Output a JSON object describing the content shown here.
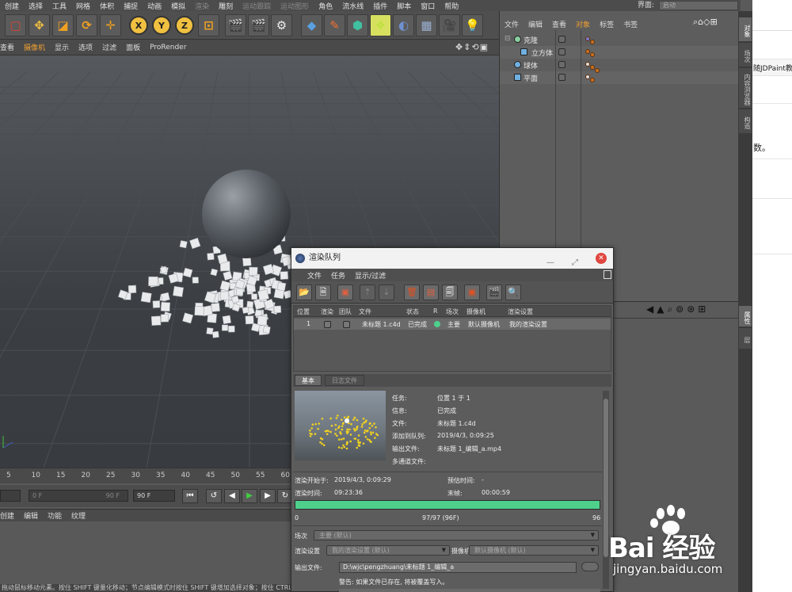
{
  "menubar": {
    "items": [
      "创建",
      "选择",
      "工具",
      "网格",
      "体积",
      "捕捉",
      "动画",
      "模拟",
      "渲染",
      "雕刻",
      "运动跟踪",
      "运动图形",
      "角色",
      "流水线",
      "插件",
      "脚本",
      "窗口",
      "帮助"
    ],
    "layout_label": "界面:",
    "layout_value": "启动"
  },
  "toolbar": {
    "xyz": [
      "X",
      "Y",
      "Z"
    ]
  },
  "viewport": {
    "menu": [
      "摄像机",
      "显示",
      "选项",
      "过滤",
      "面板",
      "ProRender"
    ],
    "menu_prefix": "查看",
    "nav_glyphs": "✥⇕⟲▣"
  },
  "timeline": {
    "ticks": [
      "5",
      "10",
      "15",
      "20",
      "25",
      "30",
      "35",
      "40",
      "45",
      "50",
      "55",
      "60"
    ],
    "start_field": "0 F",
    "end_field": "90 F",
    "fps_field": "90 F"
  },
  "material_menu": [
    "创建",
    "编辑",
    "功能",
    "纹理"
  ],
  "status_text": "拖动鼠标移动元素。按住 SHIFT 键量化移动；节点编辑模式时按住 SHIFT 键增加选择对象；按住 CTRL 键减少选择对象。",
  "object_manager": {
    "menu": [
      "文件",
      "编辑",
      "查看",
      "对象",
      "标签",
      "书签"
    ],
    "objects": [
      {
        "name": "克隆",
        "indent": 0
      },
      {
        "name": "立方体",
        "indent": 1
      },
      {
        "name": "球体",
        "indent": 0
      },
      {
        "name": "平面",
        "indent": 0
      }
    ]
  },
  "side_tabs": [
    "对象",
    "场次",
    "内容浏览器",
    "构造"
  ],
  "side_tabs_lower": [
    "属性",
    "层"
  ],
  "webpage": {
    "text1": "随JDPaint教",
    "text2": "数。"
  },
  "render_queue": {
    "title": "渲染队列",
    "menu": [
      "文件",
      "任务",
      "显示/过滤"
    ],
    "columns": [
      "位置",
      "渲染",
      "团队",
      "文件",
      "状态",
      "R",
      "场次",
      "摄像机",
      "渲染设置"
    ],
    "row": {
      "position": "1",
      "file": "未标题 1.c4d",
      "status": "已完成",
      "take": "主要",
      "camera": "默认摄像机",
      "settings": "我的渲染设置",
      "status_color": "#4ed08c"
    },
    "tabs": [
      "基本",
      "日志文件"
    ],
    "info": [
      {
        "label": "任务:",
        "value": "位置 1 于 1"
      },
      {
        "label": "信息:",
        "value": "已完成"
      },
      {
        "label": "文件:",
        "value": "未标题 1.c4d"
      },
      {
        "label": "添加到队列:",
        "value": "2019/4/3, 0:09:25"
      },
      {
        "label": "输出文件:",
        "value": "未标题 1_编辑_a.mp4"
      },
      {
        "label": "多通道文件:",
        "value": ""
      }
    ],
    "render_start_label": "渲染开始于:",
    "render_start_value": "2019/4/3, 0:09:29",
    "estimate_label": "预估时间:",
    "estimate_value": "-",
    "render_time_label": "渲染时间:",
    "render_time_value": "09:23:36",
    "last_frame_label": "末帧:",
    "last_frame_value": "00:00:59",
    "progress": 1.0,
    "progress_start": "0",
    "progress_mid": "97/97 (96F)",
    "progress_end": "96",
    "take_label": "场次",
    "take_value": "主要 (默认)",
    "render_settings_label": "渲染设置",
    "render_settings_value": "我的渲染设置 (默认)",
    "camera_label": "摄像机",
    "camera_value": "默认摄像机 (默认)",
    "output_label": "输出文件:",
    "output_value": "D:\\wjc\\pengzhuang\\未标题 1_编辑_a",
    "warning": "警告: 如果文件已存在, 将被覆盖写入。"
  },
  "watermark": {
    "logo": "Bai 经验",
    "url": "jingyan.baidu.com"
  },
  "colors": {
    "accent": "#f0a030",
    "progress": "#4ed08c",
    "close": "#e0473f"
  }
}
